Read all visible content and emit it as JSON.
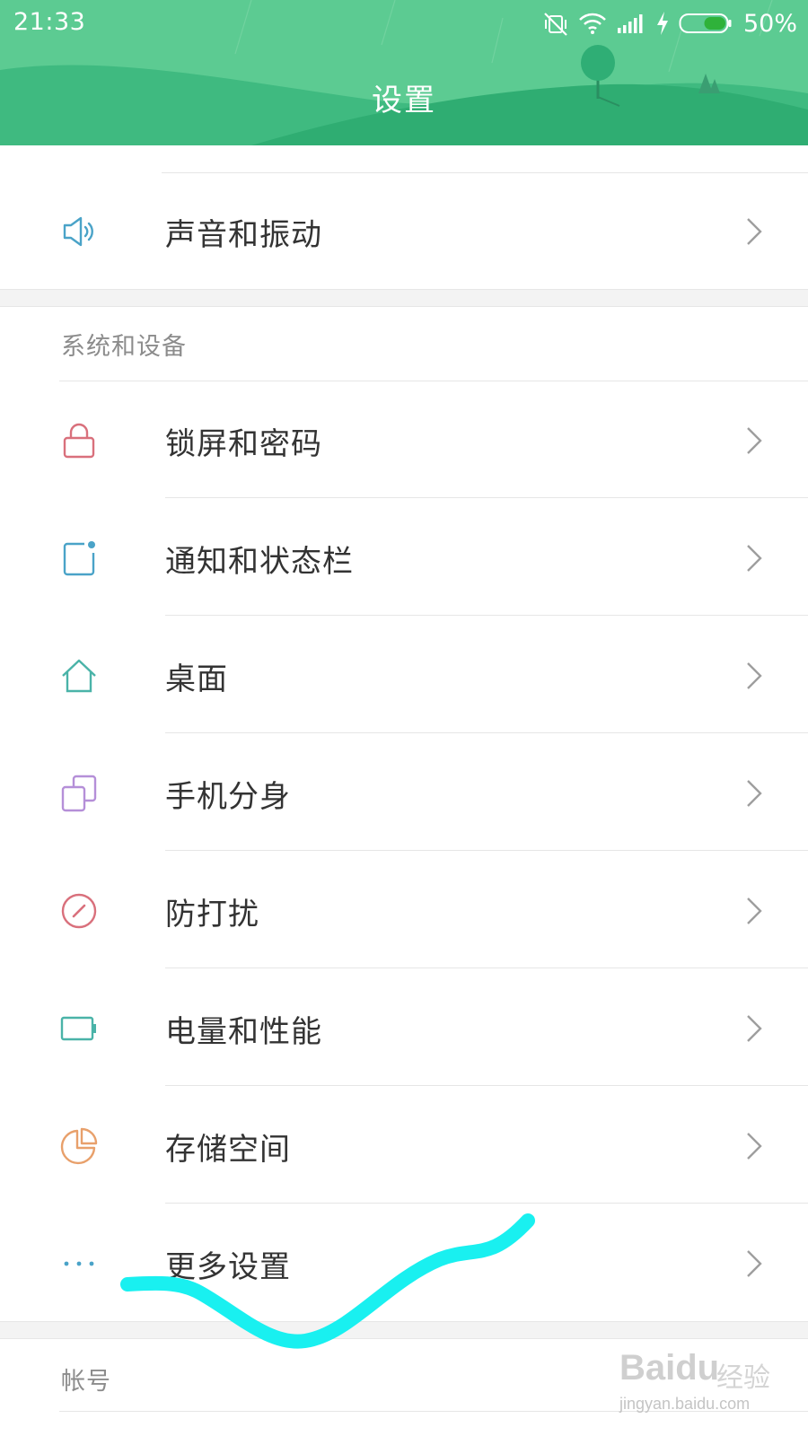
{
  "status_bar": {
    "time": "21:33",
    "battery_percent": "50%",
    "battery_level": 0.5,
    "icons": [
      "vibrate-off-icon",
      "wifi-icon",
      "signal-icon",
      "charging-icon",
      "battery-icon"
    ]
  },
  "header": {
    "title": "设置",
    "color": "#5ccb92"
  },
  "sections": {
    "top_items": [
      {
        "label": "声音和振动",
        "icon": "speaker-icon",
        "icon_color": "#4aa3c8"
      }
    ],
    "system": {
      "header": "系统和设备",
      "items": [
        {
          "label": "锁屏和密码",
          "icon": "lock-icon",
          "icon_color": "#d9707c"
        },
        {
          "label": "通知和状态栏",
          "icon": "notification-icon",
          "icon_color": "#4aa3c8"
        },
        {
          "label": "桌面",
          "icon": "home-icon",
          "icon_color": "#4ab3a8"
        },
        {
          "label": "手机分身",
          "icon": "clone-icon",
          "icon_color": "#b58fd8"
        },
        {
          "label": "防打扰",
          "icon": "do-not-disturb-icon",
          "icon_color": "#d9707c"
        },
        {
          "label": "电量和性能",
          "icon": "battery-icon",
          "icon_color": "#4ab3a8"
        },
        {
          "label": "存储空间",
          "icon": "storage-pie-icon",
          "icon_color": "#e8a06b"
        },
        {
          "label": "更多设置",
          "icon": "more-dots-icon",
          "icon_color": "#4aa3c8"
        }
      ]
    },
    "account": {
      "header": "帐号"
    }
  },
  "watermark": {
    "brand": "Baidu",
    "brand_suffix": "经验",
    "url": "jingyan.baidu.com"
  },
  "annotation_color": "#19f0f0"
}
